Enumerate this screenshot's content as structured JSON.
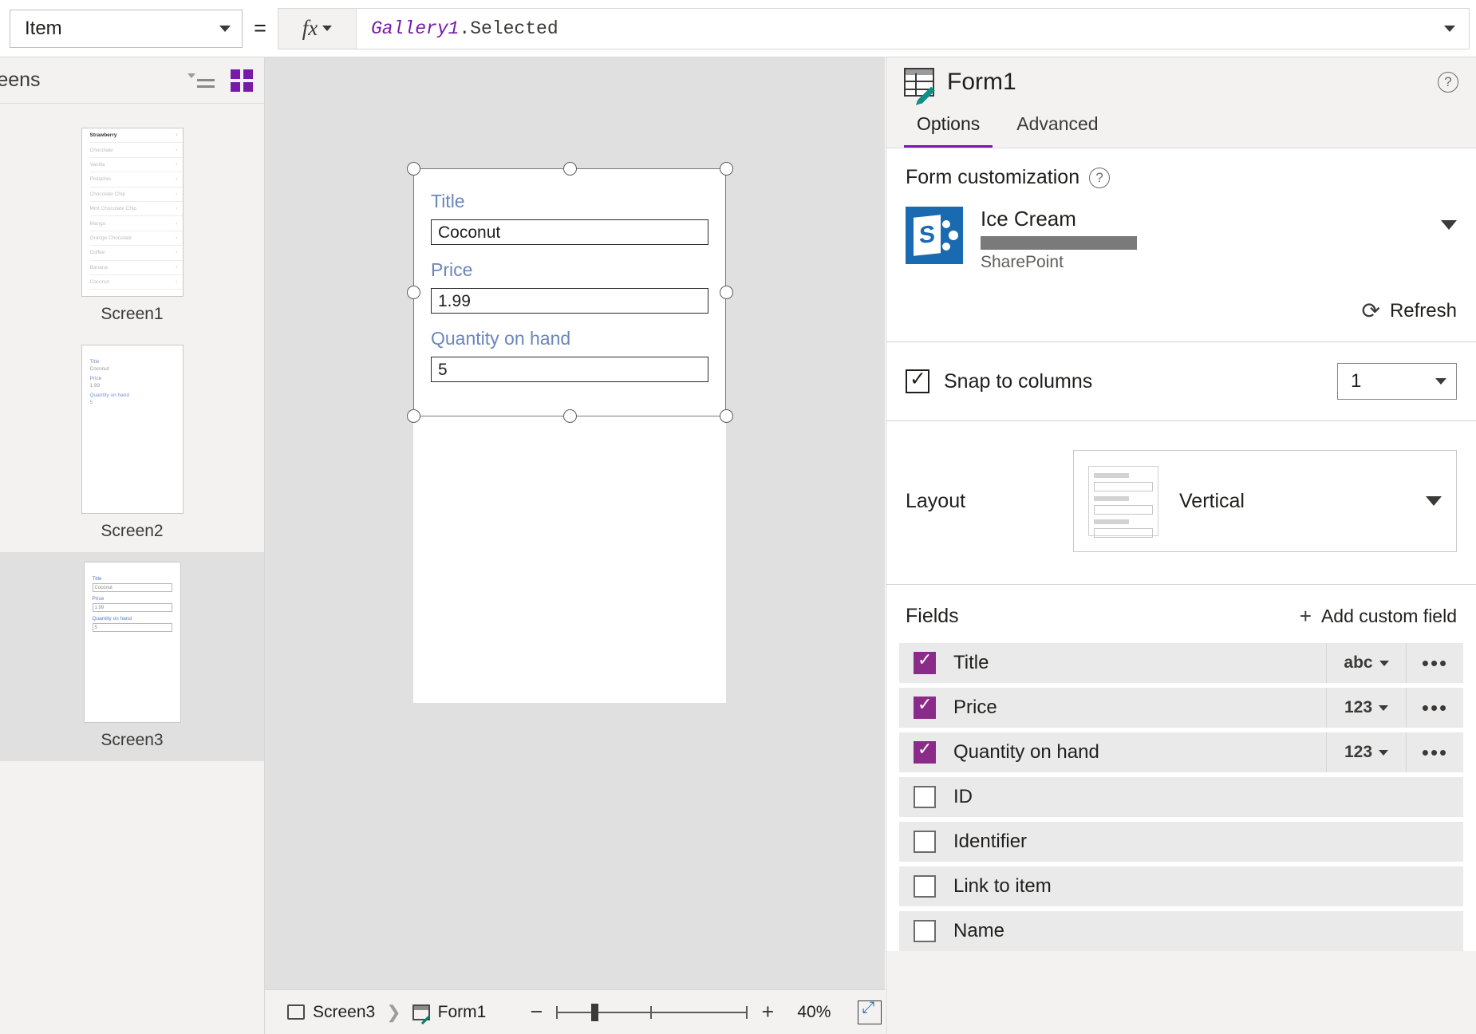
{
  "formula_bar": {
    "property": "Item",
    "equals": "=",
    "fx_label": "fx",
    "formula_object": "Gallery1",
    "formula_property": ".Selected"
  },
  "left_panel": {
    "title": "reens",
    "screens": [
      {
        "name": "Screen1"
      },
      {
        "name": "Screen2"
      },
      {
        "name": "Screen3"
      }
    ],
    "gallery_items": [
      "Strawberry",
      "Chocolate",
      "Vanilla",
      "Pistachio",
      "Chocolate Chip",
      "Mint Chocolate Chip",
      "Mango",
      "Orange Chocolate",
      "Coffee",
      "Banana",
      "Coconut"
    ],
    "thumb_form": {
      "title_label": "Title",
      "title_value": "Coconut",
      "price_label": "Price",
      "price_value": "1.99",
      "qty_label": "Quantity on hand",
      "qty_value": "5"
    }
  },
  "canvas": {
    "form": {
      "fields": [
        {
          "label": "Title",
          "value": "Coconut"
        },
        {
          "label": "Price",
          "value": "1.99"
        },
        {
          "label": "Quantity on hand",
          "value": "5"
        }
      ]
    }
  },
  "status_bar": {
    "breadcrumb_screen": "Screen3",
    "breadcrumb_control": "Form1",
    "zoom_out": "−",
    "zoom_in": "+",
    "zoom_value": "40%"
  },
  "right_panel": {
    "title": "Form1",
    "tabs": [
      {
        "label": "Options",
        "active": true
      },
      {
        "label": "Advanced",
        "active": false
      }
    ],
    "form_customization": {
      "heading": "Form customization",
      "help": "?",
      "data_source_name": "Ice Cream",
      "data_source_type": "SharePoint",
      "refresh_label": "Refresh"
    },
    "snap": {
      "label": "Snap to columns",
      "columns_value": "1"
    },
    "layout": {
      "label": "Layout",
      "value": "Vertical"
    },
    "fields": {
      "heading": "Fields",
      "add_label": "Add custom field",
      "rows": [
        {
          "name": "Title",
          "checked": true,
          "type": "abc",
          "more": "•••"
        },
        {
          "name": "Price",
          "checked": true,
          "type": "123",
          "more": "•••"
        },
        {
          "name": "Quantity on hand",
          "checked": true,
          "type": "123",
          "more": "•••"
        },
        {
          "name": "ID",
          "checked": false,
          "type": "",
          "more": ""
        },
        {
          "name": "Identifier",
          "checked": false,
          "type": "",
          "more": ""
        },
        {
          "name": "Link to item",
          "checked": false,
          "type": "",
          "more": ""
        },
        {
          "name": "Name",
          "checked": false,
          "type": "",
          "more": ""
        }
      ]
    }
  },
  "colors": {
    "accent_purple": "#7719aa",
    "checkbox_purple": "#8a2b8a",
    "label_blue": "#6a86bd",
    "sharepoint_blue": "#1a6ab1",
    "teal": "#0f8f86"
  }
}
